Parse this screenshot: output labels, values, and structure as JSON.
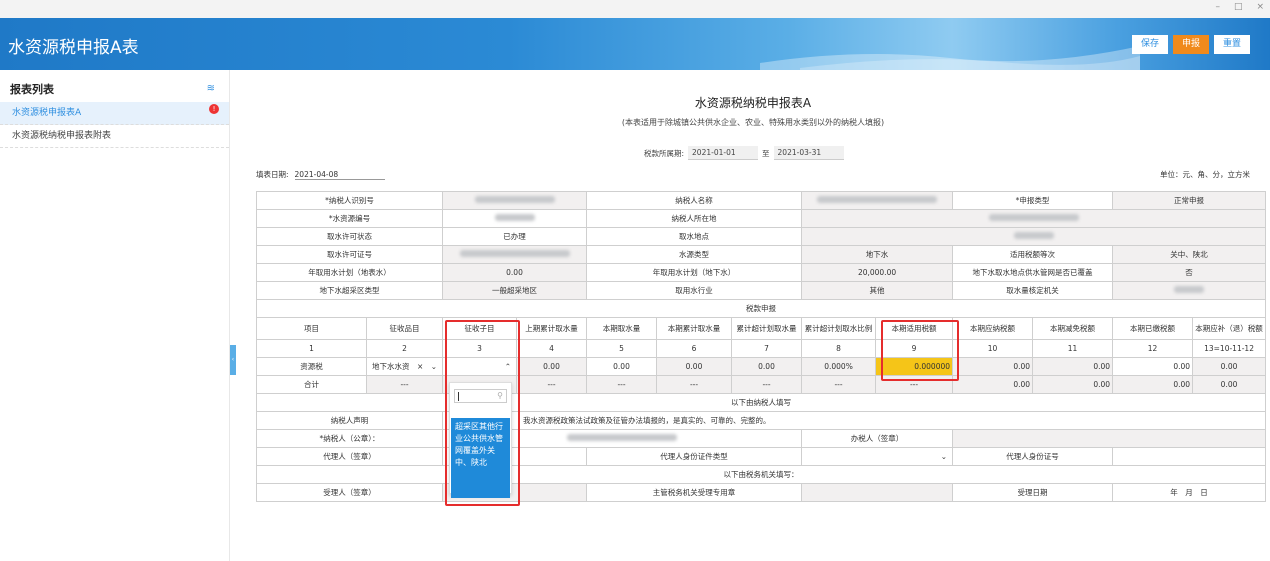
{
  "window": {
    "minimize": "–",
    "maximize": "□",
    "close": "×"
  },
  "header": {
    "title": "水资源税申报A表",
    "save_label": "保存",
    "declare_label": "申报",
    "reset_label": "重置"
  },
  "sidebar": {
    "title": "报表列表",
    "items": [
      {
        "label": "水资源税申报表A",
        "badge": "!"
      },
      {
        "label": "水资源税纳税申报表附表"
      }
    ]
  },
  "form": {
    "title": "水资源税纳税申报表A",
    "subtitle": "(本表适用于除城镇公共供水企业、农业、特殊用水类别以外的纳税人填报)",
    "period_label": "税款所属期:",
    "period_start": "2021-01-01",
    "period_to": "至",
    "period_end": "2021-03-31",
    "fill_date_label": "填表日期:",
    "fill_date": "2021-04-08",
    "unit": "单位：元、角、分，立方米"
  },
  "info": {
    "taxpayer_id_label": "*纳税人识别号",
    "taxpayer_name_label": "纳税人名称",
    "declare_type_label": "*申报类型",
    "declare_type": "正常申报",
    "water_no_label": "*水资源编号",
    "taxpayer_location_label": "纳税人所在地",
    "permit_status_label": "取水许可状态",
    "permit_status": "已办理",
    "intake_location_label": "取水地点",
    "permit_no_label": "取水许可证号",
    "water_type_label": "水源类型",
    "water_type": "地下水",
    "rate_level_label": "适用税额等次",
    "rate_level": "关中、陕北",
    "annual_plan_label": "年取用水计划（地表水）",
    "annual_plan": "0.00",
    "annual_plan_gw_label": "年取用水计划（地下水）",
    "annual_plan_gw": "20,000.00",
    "pipe_cover_label": "地下水取水地点供水管网是否已覆盖",
    "pipe_cover": "否",
    "overdraft_type_label": "地下水超采区类型",
    "overdraft_type": "一般超采地区",
    "industry_label": "取用水行业",
    "industry": "其他",
    "authority_label": "取水量核定机关"
  },
  "tax_section_title": "税款申报",
  "columns": [
    {
      "label": "项目",
      "no": "1"
    },
    {
      "label": "征收品目",
      "no": "2"
    },
    {
      "label": "征收子目",
      "no": "3"
    },
    {
      "label": "上期累计取水量",
      "no": "4"
    },
    {
      "label": "本期取水量",
      "no": "5"
    },
    {
      "label": "本期累计取水量",
      "no": "6"
    },
    {
      "label": "累计超计划取水量",
      "no": "7"
    },
    {
      "label": "累计超计划取水比例",
      "no": "8"
    },
    {
      "label": "本期适用税额",
      "no": "9"
    },
    {
      "label": "本期应纳税额",
      "no": "10"
    },
    {
      "label": "本期减免税额",
      "no": "11"
    },
    {
      "label": "本期已缴税额",
      "no": "12"
    },
    {
      "label": "本期应补（退）税额",
      "no": "13=10-11-12"
    }
  ],
  "row_tax": [
    "资源税",
    "地下水水资",
    "",
    "0.00",
    "0.00",
    "0.00",
    "0.00",
    "0.000%",
    "0.000000",
    "0.00",
    "0.00",
    "0.00",
    "0.00"
  ],
  "row_total": [
    "合计",
    "---",
    "",
    "---",
    "---",
    "---",
    "---",
    "---",
    "---",
    "0.00",
    "0.00",
    "0.00",
    "0.00"
  ],
  "taxpayer_fill_title": "以下由纳税人填写",
  "declaration_label": "纳税人声明",
  "declaration_text": "我水资源税政策法试政策及征管办法填报的，是真实的、可靠的、完整的。",
  "taxpayer_seal_label": "*纳税人（公章）：",
  "handler_label": "办税人（签章）",
  "agent_label": "代理人（签章）",
  "agent_id_type_label": "代理人身份证件类型",
  "agent_id_no_label": "代理人身份证号",
  "authority_fill_title": "以下由税务机关填写：",
  "receiver_label": "受理人（签章）",
  "receiver_seal_label": "主管税务机关受理专用章",
  "receive_date_label": "受理日期",
  "receive_date_text": "年　月　日",
  "dropdown": {
    "option": "超采区其他行业公共供水管网覆盖外关中、陕北"
  }
}
